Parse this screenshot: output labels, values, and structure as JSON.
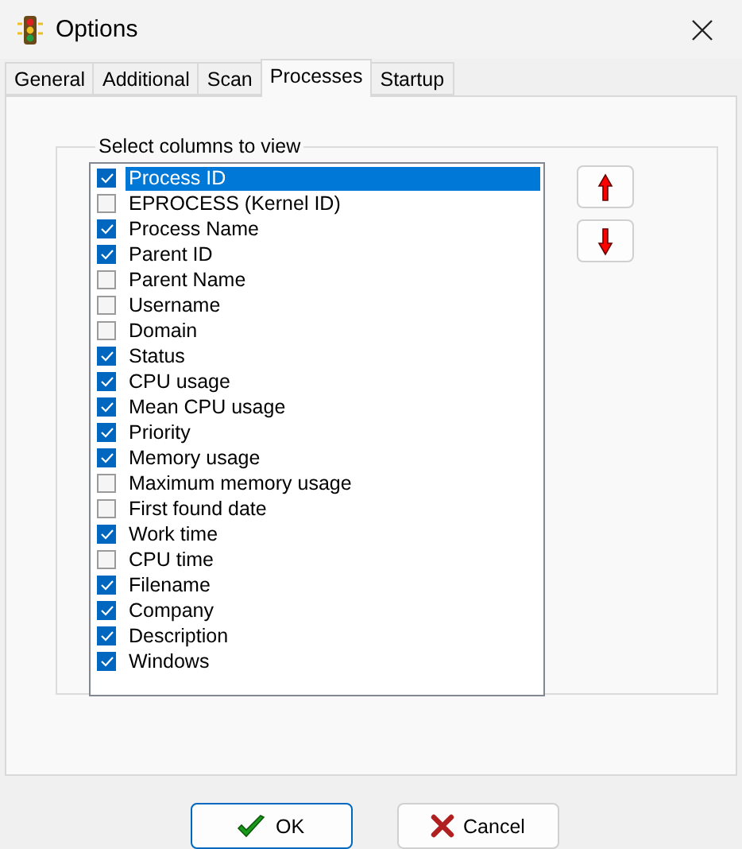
{
  "window": {
    "title": "Options"
  },
  "tabs": [
    {
      "label": "General",
      "selected": false
    },
    {
      "label": "Additional",
      "selected": false
    },
    {
      "label": "Scan",
      "selected": false
    },
    {
      "label": "Processes",
      "selected": true
    },
    {
      "label": "Startup",
      "selected": false
    }
  ],
  "group": {
    "title": "Select columns to view"
  },
  "columns": [
    {
      "label": "Process ID",
      "checked": true,
      "selected": true
    },
    {
      "label": "EPROCESS (Kernel ID)",
      "checked": false,
      "selected": false
    },
    {
      "label": "Process Name",
      "checked": true,
      "selected": false
    },
    {
      "label": "Parent ID",
      "checked": true,
      "selected": false
    },
    {
      "label": "Parent Name",
      "checked": false,
      "selected": false
    },
    {
      "label": "Username",
      "checked": false,
      "selected": false
    },
    {
      "label": "Domain",
      "checked": false,
      "selected": false
    },
    {
      "label": "Status",
      "checked": true,
      "selected": false
    },
    {
      "label": "CPU usage",
      "checked": true,
      "selected": false
    },
    {
      "label": "Mean CPU usage",
      "checked": true,
      "selected": false
    },
    {
      "label": "Priority",
      "checked": true,
      "selected": false
    },
    {
      "label": "Memory usage",
      "checked": true,
      "selected": false
    },
    {
      "label": "Maximum memory usage",
      "checked": false,
      "selected": false
    },
    {
      "label": "First found date",
      "checked": false,
      "selected": false
    },
    {
      "label": "Work time",
      "checked": true,
      "selected": false
    },
    {
      "label": "CPU time",
      "checked": false,
      "selected": false
    },
    {
      "label": "Filename",
      "checked": true,
      "selected": false
    },
    {
      "label": "Company",
      "checked": true,
      "selected": false
    },
    {
      "label": "Description",
      "checked": true,
      "selected": false
    },
    {
      "label": "Windows",
      "checked": true,
      "selected": false
    }
  ],
  "buttons": [
    {
      "kind": "ok",
      "label": "OK"
    },
    {
      "kind": "cancel",
      "label": "Cancel"
    }
  ]
}
